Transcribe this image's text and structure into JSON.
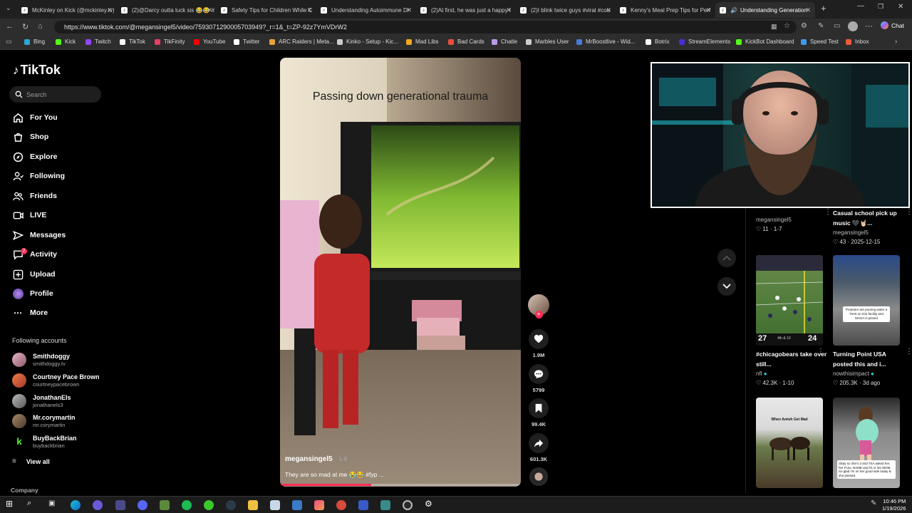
{
  "browser": {
    "tabs": [
      {
        "label": "McKinley on Kick (@mckinley.tv)",
        "active": false
      },
      {
        "label": "(2)@Darcy outta luck sis 😂😂 #",
        "active": false
      },
      {
        "label": "Safety Tips for Children While C",
        "active": false
      },
      {
        "label": "Understanding Autoimmune Di",
        "active": false
      },
      {
        "label": "(2)At first, he was just a happy l",
        "active": false
      },
      {
        "label": "(2)I blink twice guys #viral #cou",
        "active": false
      },
      {
        "label": "Kenny's Meal Prep Tips for Perf",
        "active": false
      },
      {
        "label": "Understanding Generation",
        "active": true
      }
    ],
    "url": "https://www.tiktok.com/@megansingel5/video/7593071290005703949?_r=1&_t=ZP-92z7YmVDrW2",
    "bookmarks": [
      {
        "label": "Bing",
        "color": "#2aa8d9"
      },
      {
        "label": "Kick",
        "color": "#53fc18"
      },
      {
        "label": "Twitch",
        "color": "#9146ff"
      },
      {
        "label": "TikTok",
        "color": "#ffffff"
      },
      {
        "label": "TikFinity",
        "color": "#e83e63"
      },
      {
        "label": "YouTube",
        "color": "#ff0000"
      },
      {
        "label": "Twitter",
        "color": "#ffffff"
      },
      {
        "label": "ARC Raiders | Meta...",
        "color": "#e8a23a"
      },
      {
        "label": "Kinko - Setup - Kic...",
        "color": "#cccccc"
      },
      {
        "label": "Mad Libs",
        "color": "#f5a623"
      },
      {
        "label": "Bad Cards",
        "color": "#e94e3c"
      },
      {
        "label": "Chatle",
        "color": "#b89be8"
      },
      {
        "label": "Marbles User",
        "color": "#cccccc"
      },
      {
        "label": "MrBoostlive - Wid...",
        "color": "#4a7ad9"
      },
      {
        "label": "Botrix",
        "color": "#ffffff"
      },
      {
        "label": "StreamElements",
        "color": "#4b2bd6"
      },
      {
        "label": "KickBot Dashboard",
        "color": "#53fc18"
      },
      {
        "label": "Speed Test",
        "color": "#3c9bf0"
      },
      {
        "label": "Inbox",
        "color": "#e85c3c"
      }
    ],
    "chat_label": "Chat"
  },
  "tiktok": {
    "logo": "TikTok",
    "search_placeholder": "Search",
    "nav": [
      {
        "label": "For You",
        "icon": "home-icon",
        "active": true
      },
      {
        "label": "Shop",
        "icon": "shop-icon"
      },
      {
        "label": "Explore",
        "icon": "compass-icon"
      },
      {
        "label": "Following",
        "icon": "following-icon"
      },
      {
        "label": "Friends",
        "icon": "friends-icon"
      },
      {
        "label": "LIVE",
        "icon": "live-icon"
      },
      {
        "label": "Messages",
        "icon": "messages-icon"
      },
      {
        "label": "Activity",
        "icon": "activity-icon"
      },
      {
        "label": "Upload",
        "icon": "upload-icon"
      },
      {
        "label": "Profile",
        "icon": "profile-icon"
      },
      {
        "label": "More",
        "icon": "more-icon"
      }
    ],
    "activity_badge": "2",
    "following_title": "Following accounts",
    "following_accounts": [
      {
        "name": "Smithdoggy",
        "handle": "smithdoggy.tv",
        "color": "#c9a"
      },
      {
        "name": "Courtney Pace Brown",
        "handle": "courtneypacebrown",
        "color": "#d64"
      },
      {
        "name": "JonathanEls",
        "handle": "jonathanels3",
        "color": "#888"
      },
      {
        "name": "Mr.corymartin",
        "handle": "mr.corymartin",
        "color": "#765"
      },
      {
        "name": "BuyBackBrian",
        "handle": "buybackbrian",
        "color": "#53fc18"
      }
    ],
    "view_all": "View all",
    "company": "Company"
  },
  "video": {
    "caption": "Passing down generational trauma",
    "username": "megansingel5",
    "date": "· 1-8",
    "description": "They are so mad at me 😭😂 #fyp ...",
    "progress": 0.38,
    "likes": "1.9M",
    "comments": "5799",
    "saves": "99.4K",
    "shares": "601.3K"
  },
  "right_column": {
    "top_items": [
      {
        "author": "megansingel5",
        "likes": "11",
        "date": "1-7"
      },
      {
        "title": "Casual school pick up music 🖤🤘🏻...",
        "author": "megansingel5",
        "likes": "43",
        "date": "2025-12-15"
      }
    ],
    "items": [
      {
        "title": "#chicagobears take over still...",
        "author": "nfl",
        "likes": "42.3K",
        "date": "1-10",
        "score_left": "27",
        "score_right": "24",
        "score_mid": "4th & 10"
      },
      {
        "title": "Turning Point USA posted this and i...",
        "author": "nowthisimpact",
        "likes": "205.3K",
        "date": "3d ago",
        "overlay": "Protestor are pouring water a Trent on ICE facility and MAGA is pissed"
      },
      {
        "title": "",
        "author": "",
        "likes": "",
        "date": "",
        "overlay": "When Amish Get Mad"
      },
      {
        "title": "",
        "author": "",
        "likes": "",
        "date": "",
        "overlay": "Okay so she's 3 and TSA asked her, her FULL NAME and #1 is her MOM. So glad I'm on her good side today & she passed."
      }
    ]
  },
  "taskbar": {
    "time": "10:46 PM",
    "date": "1/19/2026"
  }
}
